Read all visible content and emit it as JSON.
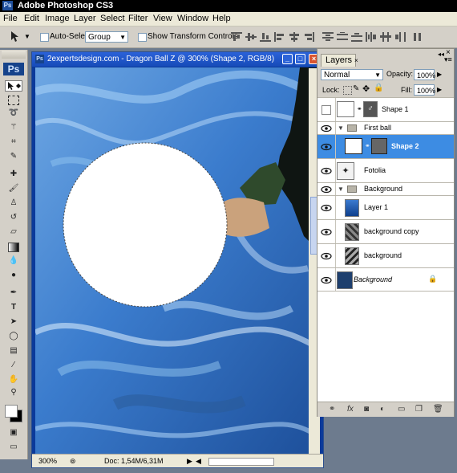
{
  "app": {
    "title": "Adobe Photoshop CS3",
    "logo": "Ps"
  },
  "menu": [
    "File",
    "Edit",
    "Image",
    "Layer",
    "Select",
    "Filter",
    "View",
    "Window",
    "Help"
  ],
  "options": {
    "auto_select_label": "Auto-Select:",
    "auto_select_value": "Group",
    "show_transform_label": "Show Transform Controls"
  },
  "document": {
    "title": "2expertsdesign.com - Dragon Ball Z @ 300% (Shape 2, RGB/8)",
    "zoom": "300%",
    "doc_info": "Doc: 1,54M/6,31M"
  },
  "layers_panel": {
    "tab_label": "Layers",
    "blend_mode": "Normal",
    "opacity_label": "Opacity:",
    "opacity_value": "100%",
    "lock_label": "Lock:",
    "fill_label": "Fill:",
    "fill_value": "100%",
    "rows": [
      {
        "name": "Shape 1",
        "visible": false,
        "selected": false
      },
      {
        "name": "First ball",
        "visible": true,
        "group": true
      },
      {
        "name": "Shape 2",
        "visible": true,
        "selected": true
      },
      {
        "name": "Fotolia",
        "visible": true
      },
      {
        "name": "Background",
        "visible": true,
        "group": true
      },
      {
        "name": "Layer 1",
        "visible": true
      },
      {
        "name": "background copy",
        "visible": true
      },
      {
        "name": "background",
        "visible": true
      },
      {
        "name": "Background",
        "visible": true,
        "locked": true,
        "italic": true
      }
    ]
  },
  "colors": {
    "selection": "#3d8ce3",
    "canvas_blue": "#3f76b8",
    "titlebar": "#164bb8"
  }
}
